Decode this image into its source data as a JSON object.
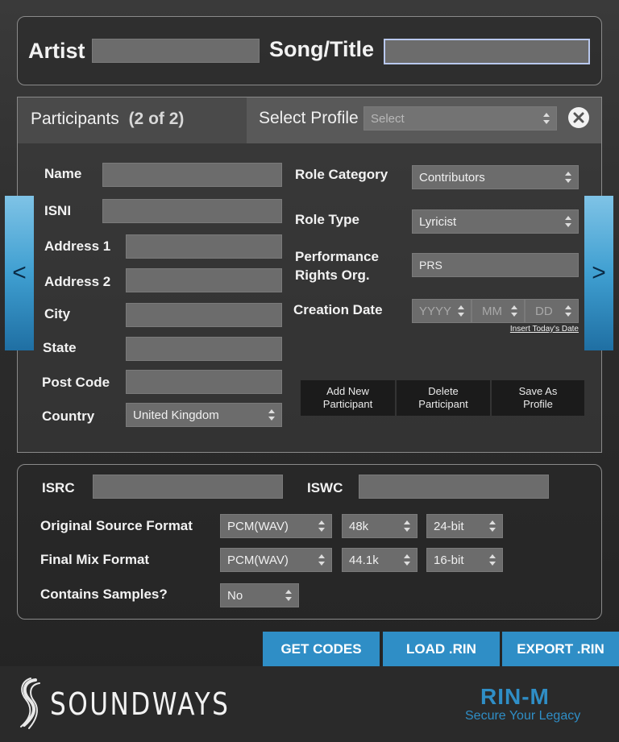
{
  "header": {
    "artist_label": "Artist",
    "artist_value": "",
    "song_label": "Song/Title",
    "song_value": ""
  },
  "participants": {
    "title": "Participants",
    "count": "(2 of 2)",
    "select_profile_label": "Select Profile",
    "select_profile_value": "Select",
    "close_icon": "close-icon",
    "prev_glyph": "<",
    "next_glyph": ">",
    "fields": {
      "name_label": "Name",
      "isni_label": "ISNI",
      "address1_label": "Address 1",
      "address2_label": "Address 2",
      "city_label": "City",
      "state_label": "State",
      "postcode_label": "Post Code",
      "country_label": "Country",
      "country_value": "United Kingdom",
      "role_category_label": "Role Category",
      "role_category_value": "Contributors",
      "role_type_label": "Role Type",
      "role_type_value": "Lyricist",
      "pro_label_1": "Performance",
      "pro_label_2": "Rights Org.",
      "pro_value": "PRS",
      "creation_date_label": "Creation Date",
      "yyyy": "YYYY",
      "mm": "MM",
      "dd": "DD",
      "insert_today": "Insert Today's Date"
    },
    "buttons": {
      "add_1": "Add New",
      "add_2": "Participant",
      "delete_1": "Delete",
      "delete_2": "Participant",
      "save_1": "Save As",
      "save_2": "Profile"
    }
  },
  "codes": {
    "isrc_label": "ISRC",
    "iswc_label": "ISWC",
    "original_label": "Original Source Format",
    "original_format": "PCM(WAV)",
    "original_rate": "48k",
    "original_bits": "24-bit",
    "final_label": "Final Mix Format",
    "final_format": "PCM(WAV)",
    "final_rate": "44.1k",
    "final_bits": "16-bit",
    "samples_label": "Contains Samples?",
    "samples_value": "No"
  },
  "actions": {
    "get_codes": "GET CODES",
    "load": "LOAD .RIN",
    "export": "EXPORT .RIN"
  },
  "footer": {
    "brand": "SOUNDWAYS",
    "product": "RIN-M",
    "tagline": "Secure Your Legacy"
  },
  "colors": {
    "accent_blue": "#2f8ec6",
    "field_gray": "#6c6c6c"
  }
}
